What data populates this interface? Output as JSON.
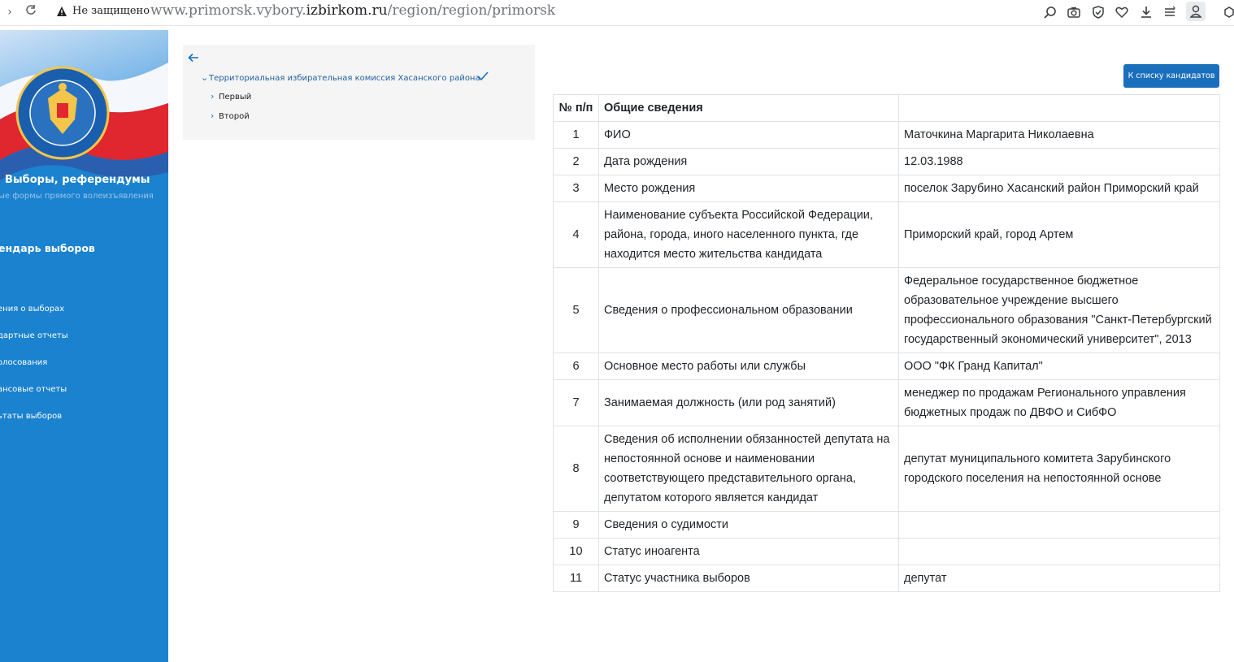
{
  "browser": {
    "not_secure_label": "Не защищено",
    "url_prefix": "www.primorsk.vybory.",
    "url_domain": "izbirkom.ru",
    "url_path": "/region/region/primorsk"
  },
  "sidebar": {
    "title": "Выборы, референдумы",
    "subtitle": "ые формы прямого волеизъявления",
    "calendar": "ендарь выборов",
    "items": [
      {
        "label": "ения о выборах"
      },
      {
        "label": "дартные отчеты"
      },
      {
        "label": "олосования"
      },
      {
        "label": "ансовые отчеты"
      },
      {
        "label": "ьтаты выборов"
      }
    ]
  },
  "tree": {
    "root_label": "Территориальная избирательная комиссия Хасанского района",
    "children": [
      {
        "label": "Первый"
      },
      {
        "label": "Второй"
      }
    ]
  },
  "candidates_button": "К списку кандидатов",
  "table": {
    "headers": [
      "№ п/п",
      "Общие сведения",
      ""
    ],
    "rows": [
      {
        "num": "1",
        "field": "ФИО",
        "value": "Маточкина Маргарита Николаевна"
      },
      {
        "num": "2",
        "field": "Дата рождения",
        "value": "12.03.1988"
      },
      {
        "num": "3",
        "field": "Место рождения",
        "value": "поселок Зарубино Хасанский район Приморский край"
      },
      {
        "num": "4",
        "field": "Наименование субъекта Российской Федерации, района, города, иного населенного пункта, где находится место жительства кандидата",
        "value": "Приморский край, город Артем"
      },
      {
        "num": "5",
        "field": "Сведения о профессиональном образовании",
        "value": "Федеральное государственное бюджетное образовательное учреждение высшего профессионального образования \"Санкт-Петербургский государственный экономический университет\", 2013"
      },
      {
        "num": "6",
        "field": "Основное место работы или службы",
        "value": "ООО \"ФК Гранд Капитал\""
      },
      {
        "num": "7",
        "field": "Занимаемая должность (или род занятий)",
        "value": "менеджер по продажам Регионального управления бюджетных продаж по ДВФО и СибФО"
      },
      {
        "num": "8",
        "field": "Сведения об исполнении обязанностей депутата на непостоянной основе и наименовании соответствующего представительного органа, депутатом которого является кандидат",
        "value": "депутат муниципального комитета Зарубинского городского поселения на непостоянной основе"
      },
      {
        "num": "9",
        "field": "Сведения о судимости",
        "value": ""
      },
      {
        "num": "10",
        "field": "Статус иноагента",
        "value": ""
      },
      {
        "num": "11",
        "field": "Статус участника выборов",
        "value": "депутат"
      }
    ]
  }
}
